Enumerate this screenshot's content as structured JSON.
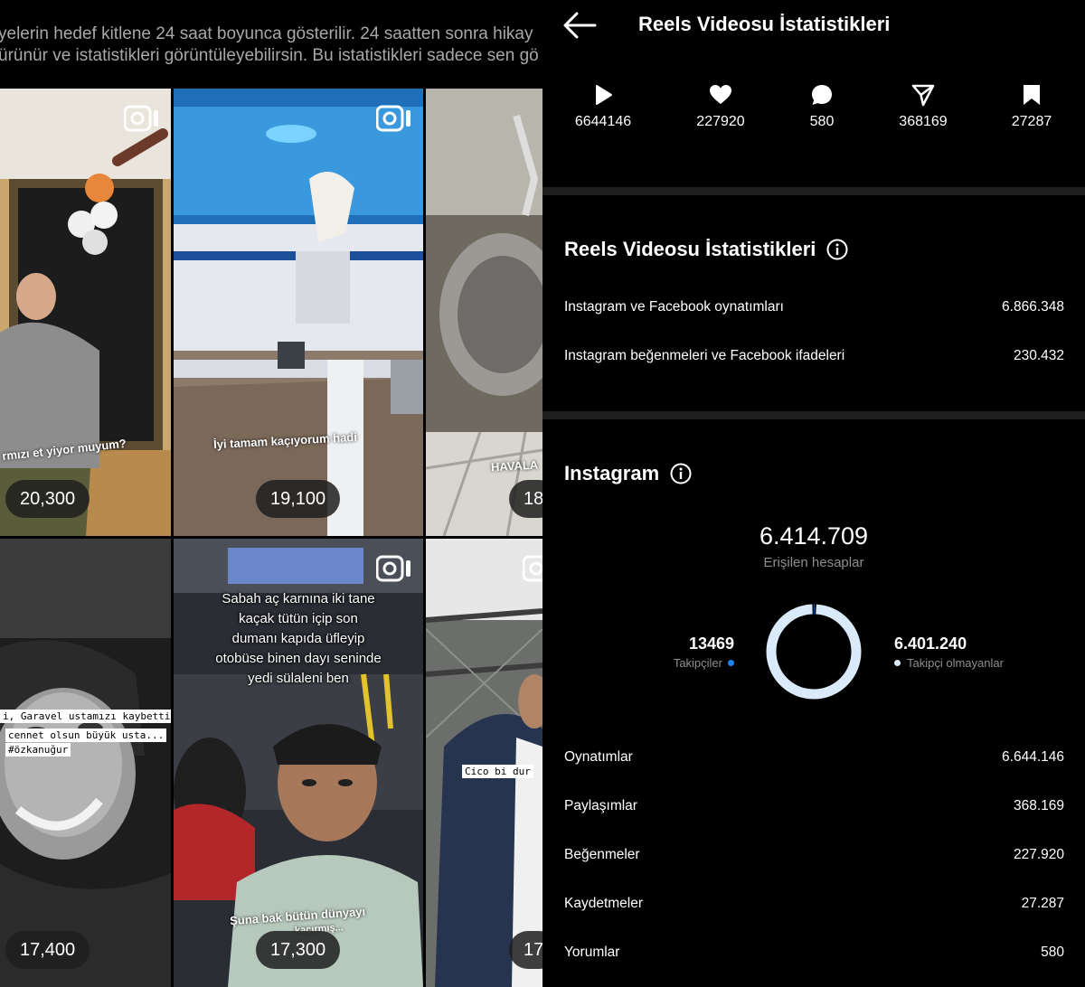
{
  "left": {
    "intro_line1": "yelerin hedef kitlene 24 saat boyunca gösterilir. 24 saatten sonra hikay",
    "intro_line2": "ürünür ve istatistikleri görüntüleyebilirsin. Bu istatistikleri sadece sen gö",
    "tiles": [
      {
        "count": "20,300",
        "caption": "rmızı et yiyor muyum?"
      },
      {
        "count": "19,100",
        "caption": "İyi tamam kaçıyorum hadi"
      },
      {
        "count": "18",
        "caption": "HAVALA"
      },
      {
        "count": "17,400",
        "caption_lines": [
          "i, Garavel ustamızı kaybettik...",
          "cennet olsun büyük usta...",
          "#özkanuğur"
        ]
      },
      {
        "count": "17,300",
        "caption": "Şuna bak bütün dünyayı",
        "caption2": "kaçırmış...",
        "overlay_lines": [
          "Sabah aç karnına iki tane",
          "kaçak tütün içip son",
          "dumanı kapıda üfleyip",
          "otobüse binen dayı seninde",
          "yedi sülaleni ben"
        ]
      },
      {
        "count": "17",
        "caption": "Cico bi dur"
      }
    ]
  },
  "right": {
    "title": "Reels Videosu İstatistikleri",
    "metrics": [
      {
        "icon": "play-icon",
        "value": "6644146"
      },
      {
        "icon": "heart-icon",
        "value": "227920"
      },
      {
        "icon": "comment-icon",
        "value": "580"
      },
      {
        "icon": "share-icon",
        "value": "368169"
      },
      {
        "icon": "bookmark-icon",
        "value": "27287"
      }
    ],
    "stats_section": {
      "title": "Reels Videosu İstatistikleri",
      "rows": [
        {
          "label": "Instagram ve Facebook oynatımları",
          "value": "6.866.348"
        },
        {
          "label": "Instagram beğenmeleri ve Facebook ifadeleri",
          "value": "230.432"
        }
      ]
    },
    "instagram_section": {
      "title": "Instagram",
      "reach_value": "6.414.709",
      "reach_label": "Erişilen hesaplar",
      "followers_value": "13469",
      "followers_label": "Takipçiler",
      "non_followers_value": "6.401.240",
      "non_followers_label": "Takipçi olmayanlar",
      "followers_fraction": 0.0021,
      "colors": {
        "followers": "#1b84f0",
        "non_followers": "#dbeafb"
      },
      "rows": [
        {
          "label": "Oynatımlar",
          "value": "6.644.146"
        },
        {
          "label": "Paylaşımlar",
          "value": "368.169"
        },
        {
          "label": "Beğenmeler",
          "value": "227.920"
        },
        {
          "label": "Kaydetmeler",
          "value": "27.287"
        },
        {
          "label": "Yorumlar",
          "value": "580"
        }
      ]
    }
  }
}
